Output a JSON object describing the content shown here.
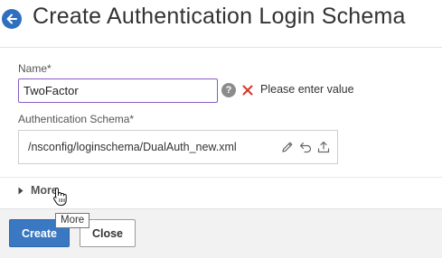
{
  "header": {
    "title": "Create Authentication Login Schema"
  },
  "form": {
    "name_label": "Name*",
    "name_value": "TwoFactor",
    "help_glyph": "?",
    "error_message": "Please enter value",
    "schema_label": "Authentication Schema*",
    "schema_value": "/nsconfig/loginschema/DualAuth_new.xml"
  },
  "more": {
    "label": "More",
    "tooltip": "More"
  },
  "footer": {
    "create_label": "Create",
    "close_label": "Close"
  },
  "icons": {
    "back": "arrow-left-icon",
    "help": "help-icon",
    "error": "close-x-icon",
    "edit": "pencil-icon",
    "undo": "undo-icon",
    "upload": "upload-icon",
    "expand": "caret-right-icon",
    "cursor": "hand-pointer-icon"
  },
  "colors": {
    "accent": "#3a78c2",
    "input_focus_border": "#8a5ac2",
    "error": "#d9342b"
  }
}
